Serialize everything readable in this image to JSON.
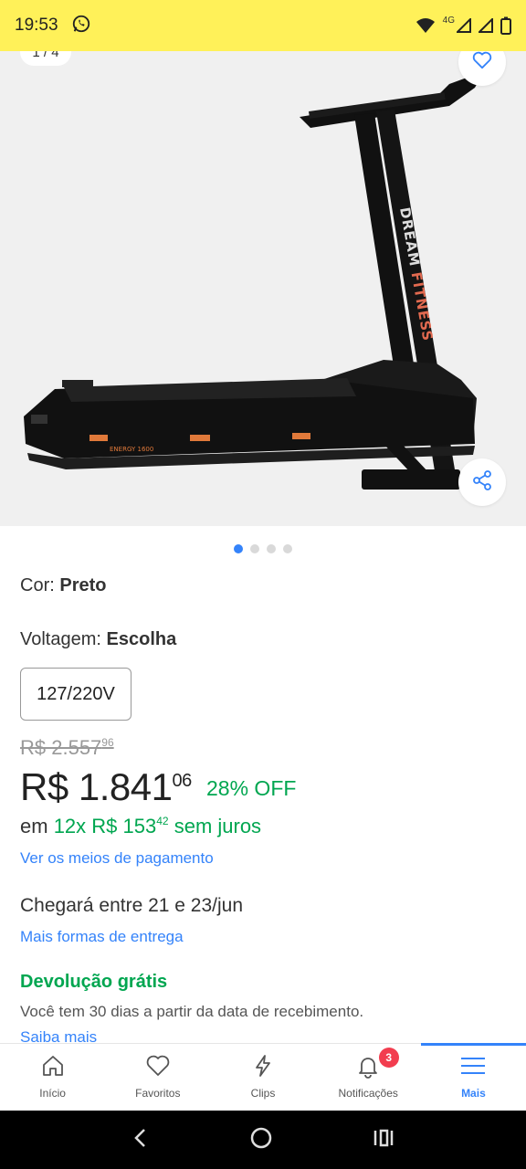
{
  "status_bar": {
    "time": "19:53",
    "network_label": "4G",
    "background_color": "#fff159",
    "icons": [
      "whatsapp-icon",
      "wifi-icon",
      "signal-icon",
      "signal-icon",
      "battery-icon"
    ]
  },
  "gallery": {
    "counter": "1 / 4",
    "total_images": 4,
    "active_index": 0,
    "brand_text": "DREAM FITNESS",
    "model_text": "ENERGY 1600"
  },
  "product": {
    "color_label": "Cor:",
    "color_value": "Preto",
    "voltage_label": "Voltagem:",
    "voltage_value": "Escolha",
    "voltage_option": "127/220V",
    "old_price_int": "R$ 2.557",
    "old_price_cents": "96",
    "price_int": "R$ 1.841",
    "price_cents": "06",
    "discount": "28% OFF",
    "installments_prefix": "em",
    "installments_value": "12x R$ 153",
    "installments_cents": "42",
    "installments_suffix": "sem juros",
    "payment_link": "Ver os meios de pagamento",
    "delivery": "Chegará entre 21 e 23/jun",
    "delivery_link": "Mais formas de entrega",
    "return_title": "Devolução grátis",
    "return_text": "Você tem 30 dias a partir da data de recebimento.",
    "return_link": "Saiba mais"
  },
  "bottom_nav": {
    "items": [
      {
        "label": "Início",
        "icon": "home-icon"
      },
      {
        "label": "Favoritos",
        "icon": "heart-icon"
      },
      {
        "label": "Clips",
        "icon": "lightning-icon"
      },
      {
        "label": "Notificações",
        "icon": "bell-icon",
        "badge": "3"
      },
      {
        "label": "Mais",
        "icon": "menu-icon",
        "active": true
      }
    ]
  },
  "colors": {
    "accent": "#3483fa",
    "green": "#00a650",
    "badge": "#f23d4f"
  }
}
